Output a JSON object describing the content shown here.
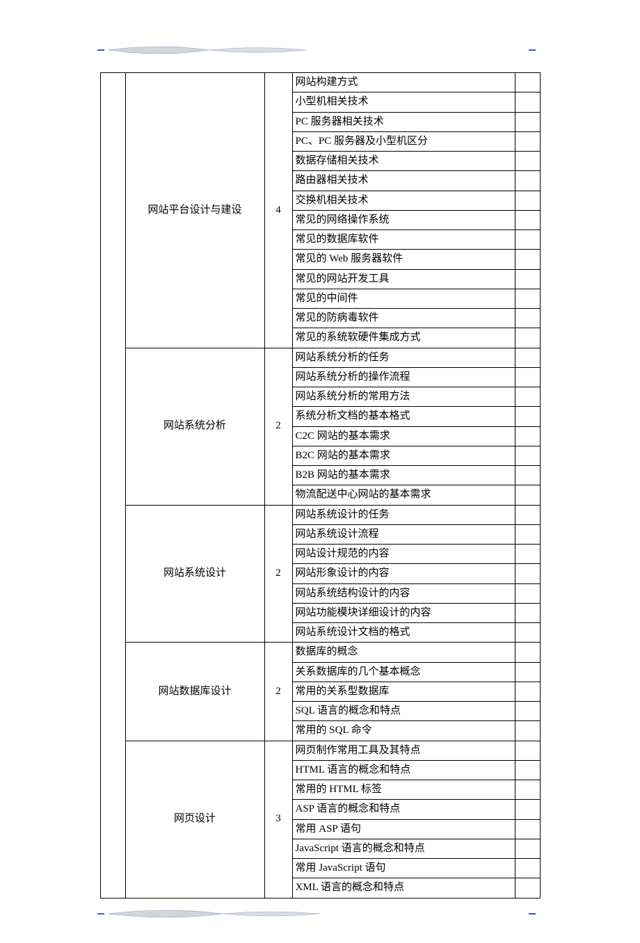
{
  "sections": [
    {
      "category": "网站平台设计与建设",
      "hours": "4",
      "topics": [
        "网站构建方式",
        "小型机相关技术",
        "PC 服务器相关技术",
        "PC、PC 服务器及小型机区分",
        "数据存储相关技术",
        "路由器相关技术",
        "交换机相关技术",
        "常见的网络操作系统",
        "常见的数据库软件",
        "常见的 Web 服务器软件",
        "常见的网站开发工具",
        "常见的中间件",
        "常见的防病毒软件",
        "常见的系统软硬件集成方式"
      ]
    },
    {
      "category": "网站系统分析",
      "hours": "2",
      "topics": [
        "网站系统分析的任务",
        "网站系统分析的操作流程",
        "网站系统分析的常用方法",
        "系统分析文档的基本格式",
        "C2C 网站的基本需求",
        "B2C 网站的基本需求",
        "B2B 网站的基本需求",
        "物流配送中心网站的基本需求"
      ]
    },
    {
      "category": "网站系统设计",
      "hours": "2",
      "topics": [
        "网站系统设计的任务",
        "网站系统设计流程",
        "网站设计规范的内容",
        "网站形象设计的内容",
        "网站系统结构设计的内容",
        "网站功能模块详细设计的内容",
        "网站系统设计文档的格式"
      ]
    },
    {
      "category": "网站数据库设计",
      "hours": "2",
      "topics": [
        "数据库的概念",
        "关系数据库的几个基本概念",
        "常用的关系型数据库",
        "SQL 语言的概念和特点",
        "常用的 SQL 命令"
      ]
    },
    {
      "category": "网页设计",
      "hours": "3",
      "topics": [
        "网页制作常用工具及其特点",
        "HTML 语言的概念和特点",
        "常用的 HTML 标签",
        "ASP 语言的概念和特点",
        "常用 ASP 语句",
        "JavaScript 语言的概念和特点",
        "常用 JavaScript 语句",
        "XML 语言的概念和特点"
      ]
    }
  ]
}
